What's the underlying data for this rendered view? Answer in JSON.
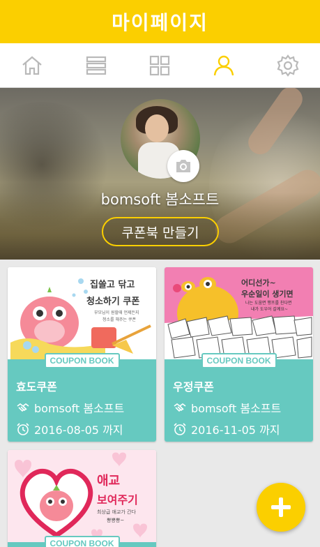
{
  "appbar": {
    "title": "마이페이지",
    "color": "#fbcf00"
  },
  "nav": [
    {
      "icon": "home-icon",
      "selected": false
    },
    {
      "icon": "list-icon",
      "selected": false
    },
    {
      "icon": "grid-icon",
      "selected": false
    },
    {
      "icon": "person-icon",
      "selected": true
    },
    {
      "icon": "gear-icon",
      "selected": false
    }
  ],
  "profile": {
    "name": "bomsoft 봄소프트",
    "make_couponbook_label": "쿠폰북 만들기",
    "camera_icon": "camera-icon"
  },
  "coupons": [
    {
      "title": "효도쿠폰",
      "badge": "COUPON BOOK",
      "owner": "bomsoft 봄소프트",
      "expiry": "2016-08-05 까지",
      "illustration": {
        "headline_1": "집쓸고 닦고",
        "headline_2": "청소하기 쿠폰",
        "sub_1": "부모님이 원할때 언제든지",
        "sub_2": "청소를 해주는 쿠폰"
      }
    },
    {
      "title": "우정쿠폰",
      "badge": "COUPON BOOK",
      "owner": "bomsoft 봄소프트",
      "expiry": "2016-11-05 까지",
      "illustration": {
        "headline_1": "어디선가~",
        "headline_2": "우순일이 생기면",
        "sub_1": "나는 도움면 행프를 친다면",
        "sub_2": "내가 도우어 갈께요~"
      }
    },
    {
      "title": "",
      "badge": "COUPON BOOK",
      "illustration": {
        "headline_1": "애교",
        "headline_2": "보여주기",
        "sub_1": "최상급 애교가 간다",
        "sub_2": "뿅뿅뿅~"
      }
    }
  ],
  "fab": {
    "icon": "plus-icon"
  },
  "colors": {
    "accent": "#fbcf00",
    "card_teal": "#66c9c0"
  }
}
